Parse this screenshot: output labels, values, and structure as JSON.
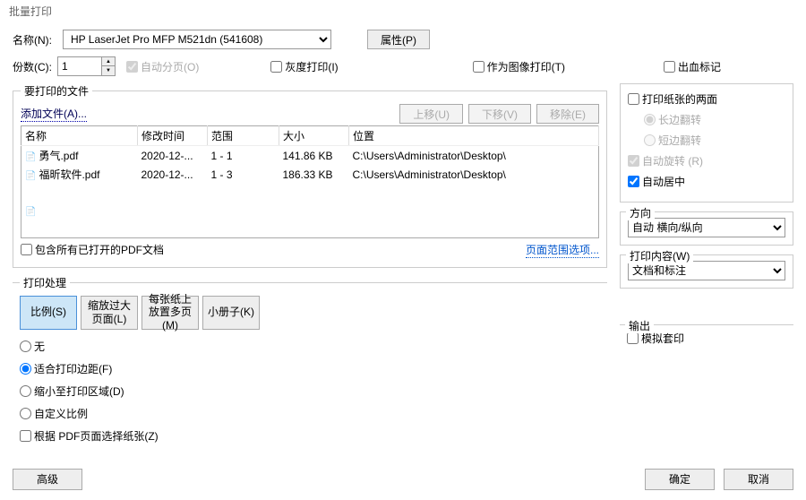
{
  "window": {
    "title": "批量打印"
  },
  "topbar": {
    "name_label": "名称(N):",
    "printer_name": "HP LaserJet Pro MFP M521dn (541608)",
    "properties_btn": "属性(P)",
    "copies_label": "份数(C):",
    "copies_value": "1",
    "collate": "自动分页(O)",
    "grayscale": "灰度打印(I)",
    "print_as_image": "作为图像打印(T)",
    "bleed_marks": "出血标记"
  },
  "files_section": {
    "legend": "要打印的文件",
    "add_files": "添加文件(A)...",
    "move_up": "上移(U)",
    "move_down": "下移(V)",
    "remove": "移除(E)",
    "headers": {
      "name": "名称",
      "mtime": "修改时间",
      "range": "范围",
      "size": "大小",
      "location": "位置"
    },
    "rows": [
      {
        "name": "勇气.pdf",
        "mtime": "2020-12-...",
        "range": "1 - 1",
        "size": "141.86 KB",
        "location": "C:\\Users\\Administrator\\Desktop\\"
      },
      {
        "name": "福昕软件.pdf",
        "mtime": "2020-12-...",
        "range": "1 - 3",
        "size": "186.33 KB",
        "location": "C:\\Users\\Administrator\\Desktop\\"
      }
    ],
    "include_open": "包含所有已打开的PDF文档",
    "page_range_options": "页面范围选项..."
  },
  "handling": {
    "legend": "打印处理",
    "scale": "比例(S)",
    "shrink": "缩放过大页面(L)",
    "multiple": "每张纸上放置多页(M)",
    "booklet": "小册子(K)",
    "none": "无",
    "fit_margins": "适合打印边距(F)",
    "shrink_area": "缩小至打印区域(D)",
    "custom_scale": "自定义比例",
    "choose_by_page": "根据 PDF页面选择纸张(Z)"
  },
  "duplex": {
    "both_sides": "打印纸张的两面",
    "flip_long": "长边翻转",
    "flip_short": "短边翻转",
    "auto_rotate": "自动旋转 (R)",
    "auto_center": "自动居中"
  },
  "orientation": {
    "label": "方向",
    "value": "自动 横向/纵向"
  },
  "print_content": {
    "label": "打印内容(W)",
    "value": "文档和标注"
  },
  "output": {
    "label": "输出",
    "simulate_overprint": "模拟套印"
  },
  "footer": {
    "advanced": "高级",
    "ok": "确定",
    "cancel": "取消"
  }
}
